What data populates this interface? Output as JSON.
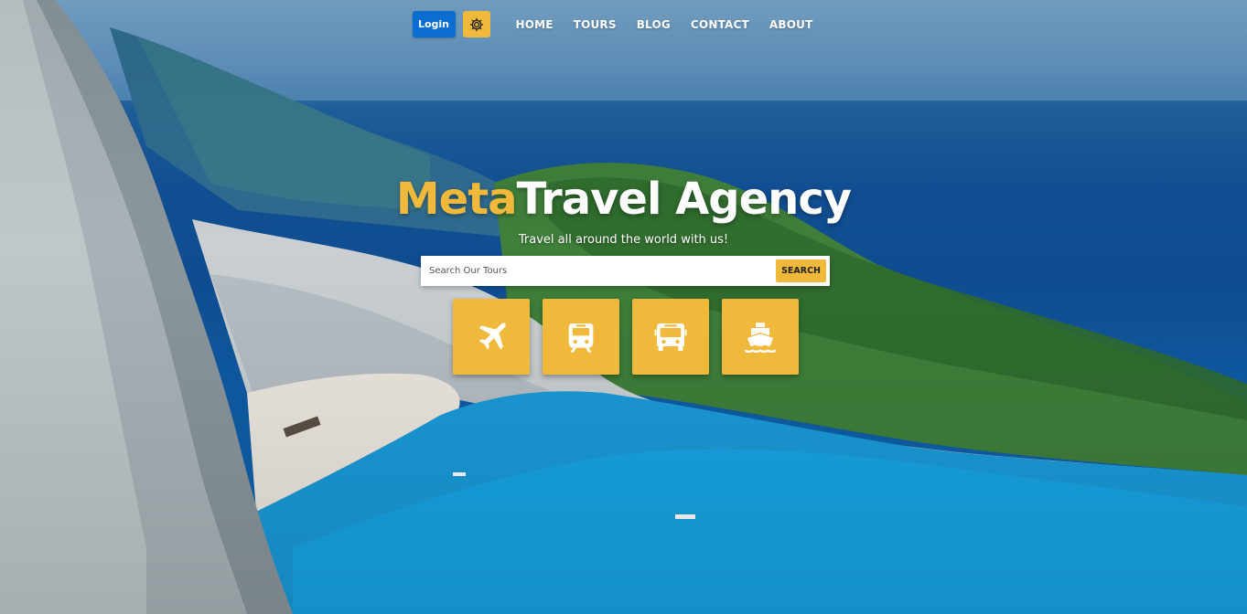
{
  "nav": {
    "login_label": "Login",
    "theme_icon": "gear-icon",
    "links": [
      "HOME",
      "TOURS",
      "BLOG",
      "CONTACT",
      "ABOUT"
    ]
  },
  "hero": {
    "title_accent": "Meta",
    "title_rest": "Travel Agency",
    "subtitle": "Travel all around the world with us!"
  },
  "search": {
    "placeholder": "Search Our Tours",
    "button_label": "SEARCH"
  },
  "categories": [
    {
      "icon": "plane-icon"
    },
    {
      "icon": "train-icon"
    },
    {
      "icon": "bus-icon"
    },
    {
      "icon": "ship-icon"
    }
  ],
  "colors": {
    "accent": "#f0b93b",
    "primary": "#0a6ed1",
    "text_light": "#ffffff"
  }
}
